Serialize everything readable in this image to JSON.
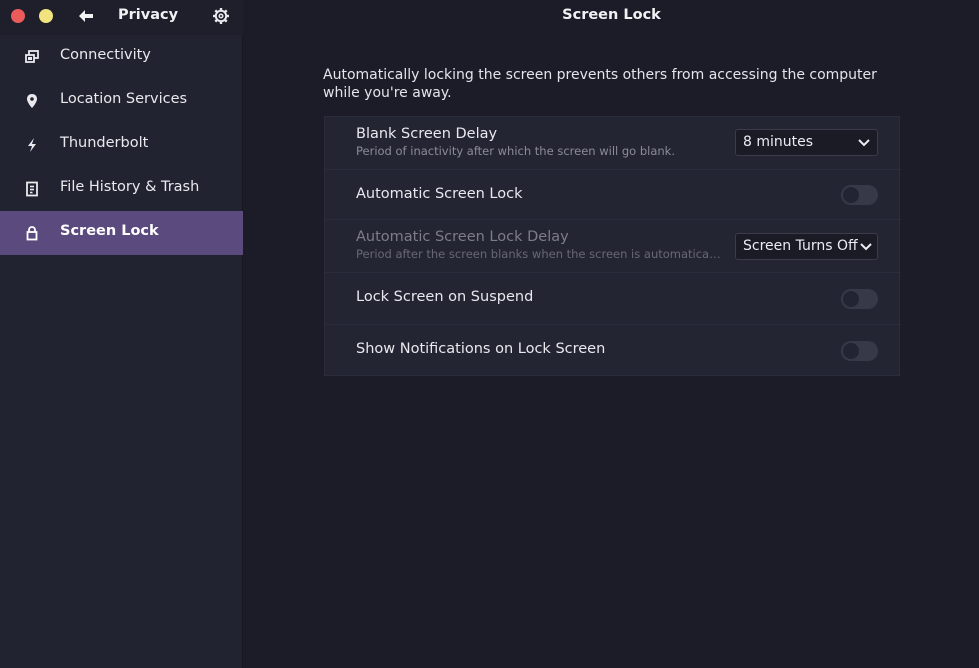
{
  "sidebar": {
    "title": "Privacy",
    "items": [
      {
        "label": "Connectivity",
        "icon": "connectivity-icon",
        "active": false
      },
      {
        "label": "Location Services",
        "icon": "location-pin-icon",
        "active": false
      },
      {
        "label": "Thunderbolt",
        "icon": "lightning-icon",
        "active": false
      },
      {
        "label": "File History & Trash",
        "icon": "file-icon",
        "active": false
      },
      {
        "label": "Screen Lock",
        "icon": "lock-icon",
        "active": true
      }
    ]
  },
  "main": {
    "title": "Screen Lock",
    "description": "Automatically locking the screen prevents others from accessing the computer while you're away.",
    "settings": {
      "blank_delay": {
        "title": "Blank Screen Delay",
        "subtitle": "Period of inactivity after which the screen will go blank.",
        "value": "8 minutes"
      },
      "auto_lock": {
        "title": "Automatic Screen Lock",
        "enabled": false
      },
      "auto_lock_delay": {
        "title": "Automatic Screen Lock Delay",
        "subtitle": "Period after the screen blanks when the screen is automatically locked.",
        "value": "Screen Turns Off",
        "disabled": true
      },
      "lock_on_suspend": {
        "title": "Lock Screen on Suspend",
        "enabled": false
      },
      "show_notifications": {
        "title": "Show Notifications on Lock Screen",
        "enabled": false
      }
    }
  },
  "colors": {
    "accent": "#5b4a7e",
    "close": "#ec5b5b",
    "minimize": "#f1e37d"
  }
}
